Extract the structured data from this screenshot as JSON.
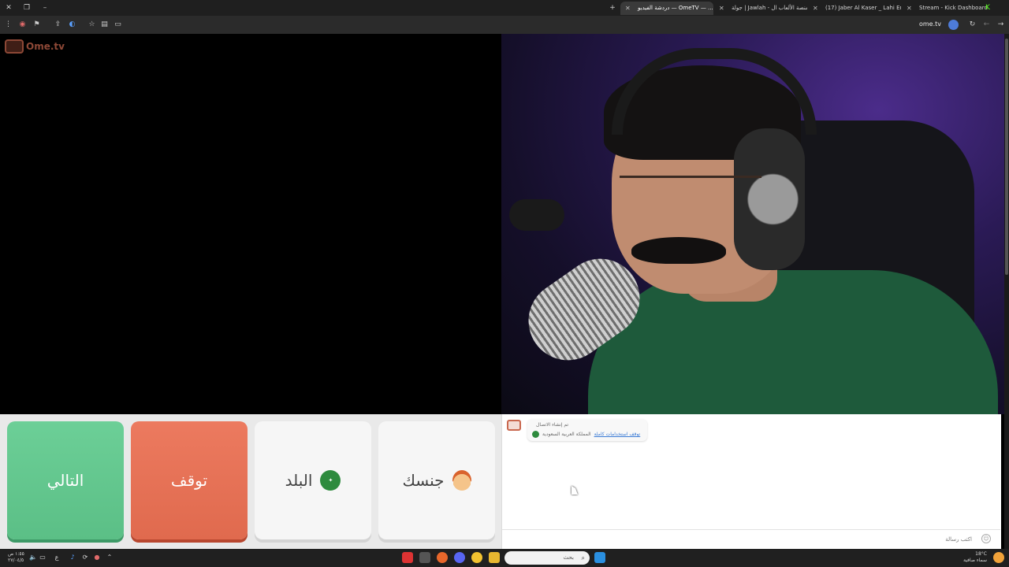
{
  "browser": {
    "tabs": [
      {
        "title": "دردشة الفيديو — OmeTV — ...",
        "favicon_color": "#e0e0e0",
        "active": true
      },
      {
        "title": "جولة | Jawlah - منصة الألعاب ال...",
        "favicon_color": "#cfcfcf",
        "active": false
      },
      {
        "title": "(17) Jaber Al Kaser _ Lahi Ent...",
        "favicon_color": "#e5263a",
        "active": false
      },
      {
        "title": "Stream - Kick Dashboard",
        "favicon_color": "#53fc18",
        "active": false
      }
    ],
    "site_label": "ome.tv",
    "icons": {
      "close": "close-icon",
      "new_tab": "plus-icon",
      "reload": "reload-icon",
      "back": "back-icon",
      "forward": "forward-icon"
    }
  },
  "app": {
    "logo_text": "Ome.tv"
  },
  "controls": {
    "next_label": "التالي",
    "stop_label": "توقف",
    "country_label": "البلد",
    "gender_label": "جنسك",
    "next_color": "#5ec78c",
    "stop_color": "#e66d51"
  },
  "chat": {
    "system_message": "تم إنشاء الاتصال",
    "country_text": "المملكة العربية السعودية",
    "link_text": "توقف استخدامات كاملة",
    "input_placeholder": "اكتب رسالة"
  },
  "taskbar": {
    "search_placeholder": "بحث",
    "time": "١:٥٥ ص",
    "date": "٢٧/٠٤/٥",
    "lang": "ع",
    "weather_temp": "18°C",
    "weather_text": "سماء صافية"
  }
}
